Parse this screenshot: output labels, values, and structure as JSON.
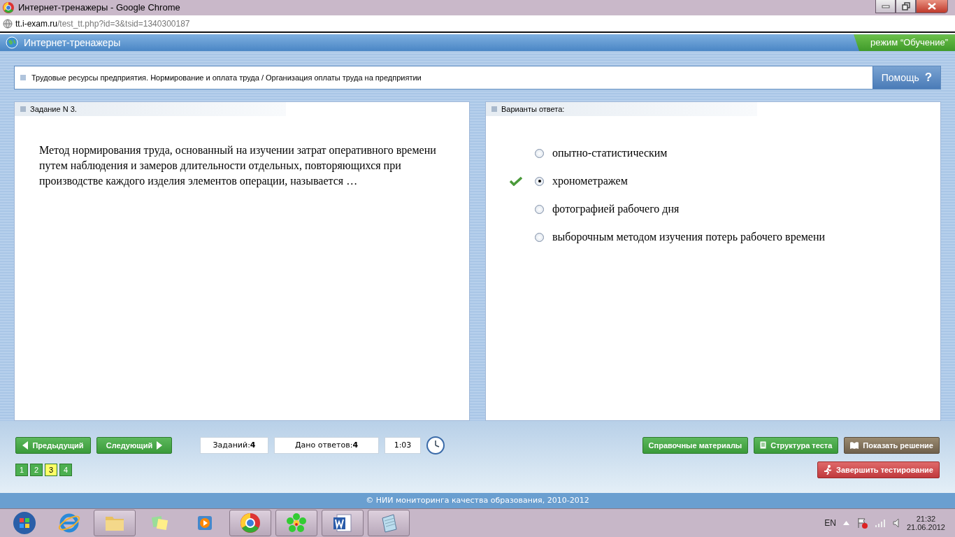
{
  "window": {
    "title": "Интернет-тренажеры - Google Chrome"
  },
  "address_bar": {
    "host": "tt.i-exam.ru",
    "path": "/test_tt.php?id=3&tsid=1340300187"
  },
  "app_header": {
    "title": "Интернет-тренажеры",
    "mode": "режим “Обучение”"
  },
  "topic": {
    "text": "Трудовые ресурсы предприятия. Нормирование и оплата труда / Организация оплаты труда на предприятии",
    "help": "Помощь",
    "help_mark": "?"
  },
  "task": {
    "heading": "Задание N 3.",
    "question": "Метод нормирования труда, основанный на изучении затрат оперативного времени путем наблюдения и замеров длительности отдельных, повторяющихся при производстве каждого изделия элементов операции, называется …"
  },
  "answers": {
    "heading": "Варианты ответа:",
    "options": [
      {
        "text": "опытно-статистическим",
        "selected": false,
        "confirmed": false
      },
      {
        "text": "хронометражем",
        "selected": true,
        "confirmed": true
      },
      {
        "text": "фотографией рабочего дня",
        "selected": false,
        "confirmed": false
      },
      {
        "text": "выборочным методом изучения потерь рабочего времени",
        "selected": false,
        "confirmed": false
      }
    ]
  },
  "nav": {
    "prev": "Предыдущий",
    "next": "Следующий"
  },
  "stats": {
    "tasks_label": "Заданий:",
    "tasks": "4",
    "answered_label": "Дано ответов:",
    "answered": "4",
    "timer": "1:03"
  },
  "actions": [
    {
      "label": "Справочные материалы",
      "kind": "green"
    },
    {
      "label": "Структура теста",
      "kind": "green"
    },
    {
      "label": "Показать решение",
      "kind": "brown"
    }
  ],
  "finish": "Завершить тестирование",
  "pages": [
    {
      "label": "1",
      "selected": false
    },
    {
      "label": "2",
      "selected": false
    },
    {
      "label": "3",
      "selected": true
    },
    {
      "label": "4",
      "selected": false
    }
  ],
  "footer": "© НИИ мониторинга качества образования, 2010-2012",
  "taskbar": {
    "lang": "EN",
    "time": "21:32",
    "date": "21.06.2012"
  }
}
